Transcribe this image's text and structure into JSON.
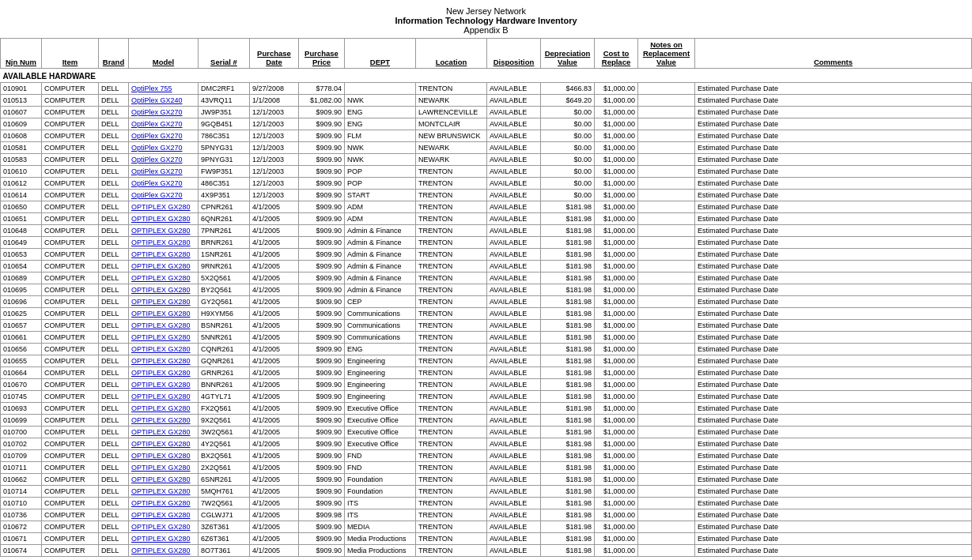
{
  "header": {
    "line1": "New Jersey Network",
    "line2": "Information Technology Hardware Inventory",
    "line3": "Appendix B"
  },
  "columns": [
    {
      "label": "Njn  Num",
      "class": "col-njn"
    },
    {
      "label": "Item",
      "class": "col-item"
    },
    {
      "label": "Brand",
      "class": "col-brand"
    },
    {
      "label": "Model",
      "class": "col-model"
    },
    {
      "label": "Serial #",
      "class": "col-serial"
    },
    {
      "label": "Purchase Date",
      "class": "col-pdate"
    },
    {
      "label": "Purchase Price",
      "class": "col-pprice"
    },
    {
      "label": "DEPT",
      "class": "col-dept"
    },
    {
      "label": "Location",
      "class": "col-location"
    },
    {
      "label": "Disposition",
      "class": "col-disp"
    },
    {
      "label": "Depreciation Value",
      "class": "col-depval"
    },
    {
      "label": "Cost to Replace",
      "class": "col-costrep"
    },
    {
      "label": "Notes on Replacement Value",
      "class": "col-notesval"
    },
    {
      "label": "Comments",
      "class": "col-comments"
    }
  ],
  "section": "AVAILABLE HARDWARE",
  "rows": [
    [
      "010901",
      "COMPUTER",
      "DELL",
      "OptiPlex 755",
      "DMC2RF1",
      "9/27/2008",
      "$778.04",
      "",
      "TRENTON",
      "AVAILABLE",
      "$466.83",
      "$1,000.00",
      "",
      "Estimated Purchase Date"
    ],
    [
      "010513",
      "COMPUTER",
      "DELL",
      "OptiPlex GX240",
      "43VRQ11",
      "1/1/2008",
      "$1,082.00",
      "NWK",
      "NEWARK",
      "AVAILABLE",
      "$649.20",
      "$1,000.00",
      "",
      "Estimated Purchase Date"
    ],
    [
      "010607",
      "COMPUTER",
      "DELL",
      "OptiPlex GX270",
      "JW9P351",
      "12/1/2003",
      "$909.90",
      "ENG",
      "LAWRENCEVILLE",
      "AVAILABLE",
      "$0.00",
      "$1,000.00",
      "",
      "Estimated Purchase Date"
    ],
    [
      "010609",
      "COMPUTER",
      "DELL",
      "OptiPlex GX270",
      "9GQB451",
      "12/1/2003",
      "$909.90",
      "ENG",
      "MONTCLAIR",
      "AVAILABLE",
      "$0.00",
      "$1,000.00",
      "",
      "Estimated Purchase Date"
    ],
    [
      "010608",
      "COMPUTER",
      "DELL",
      "OptiPlex GX270",
      "786C351",
      "12/1/2003",
      "$909.90",
      "FLM",
      "NEW BRUNSWICK",
      "AVAILABLE",
      "$0.00",
      "$1,000.00",
      "",
      "Estimated Purchase Date"
    ],
    [
      "010581",
      "COMPUTER",
      "DELL",
      "OptiPlex GX270",
      "5PNYG31",
      "12/1/2003",
      "$909.90",
      "NWK",
      "NEWARK",
      "AVAILABLE",
      "$0.00",
      "$1,000.00",
      "",
      "Estimated Purchase Date"
    ],
    [
      "010583",
      "COMPUTER",
      "DELL",
      "OptiPlex GX270",
      "9PNYG31",
      "12/1/2003",
      "$909.90",
      "NWK",
      "NEWARK",
      "AVAILABLE",
      "$0.00",
      "$1,000.00",
      "",
      "Estimated Purchase Date"
    ],
    [
      "010610",
      "COMPUTER",
      "DELL",
      "OptiPlex GX270",
      "FW9P351",
      "12/1/2003",
      "$909.90",
      "POP",
      "TRENTON",
      "AVAILABLE",
      "$0.00",
      "$1,000.00",
      "",
      "Estimated Purchase Date"
    ],
    [
      "010612",
      "COMPUTER",
      "DELL",
      "OptiPlex GX270",
      "486C351",
      "12/1/2003",
      "$909.90",
      "POP",
      "TRENTON",
      "AVAILABLE",
      "$0.00",
      "$1,000.00",
      "",
      "Estimated Purchase Date"
    ],
    [
      "010614",
      "COMPUTER",
      "DELL",
      "OptiPlex GX270",
      "4X9P351",
      "12/1/2003",
      "$909.90",
      "START",
      "TRENTON",
      "AVAILABLE",
      "$0.00",
      "$1,000.00",
      "",
      "Estimated Purchase Date"
    ],
    [
      "010650",
      "COMPUTER",
      "DELL",
      "OPTIPLEX GX280",
      "CPNR261",
      "4/1/2005",
      "$909.90",
      "ADM",
      "TRENTON",
      "AVAILABLE",
      "$181.98",
      "$1,000.00",
      "",
      "Estimated Purchase Date"
    ],
    [
      "010651",
      "COMPUTER",
      "DELL",
      "OPTIPLEX GX280",
      "6QNR261",
      "4/1/2005",
      "$909.90",
      "ADM",
      "TRENTON",
      "AVAILABLE",
      "$181.98",
      "$1,000.00",
      "",
      "Estimated Purchase Date"
    ],
    [
      "010648",
      "COMPUTER",
      "DELL",
      "OPTIPLEX GX280",
      "7PNR261",
      "4/1/2005",
      "$909.90",
      "Admin & Finance",
      "TRENTON",
      "AVAILABLE",
      "$181.98",
      "$1,000.00",
      "",
      "Estimated Purchase Date"
    ],
    [
      "010649",
      "COMPUTER",
      "DELL",
      "OPTIPLEX GX280",
      "BRNR261",
      "4/1/2005",
      "$909.90",
      "Admin & Finance",
      "TRENTON",
      "AVAILABLE",
      "$181.98",
      "$1,000.00",
      "",
      "Estimated Purchase Date"
    ],
    [
      "010653",
      "COMPUTER",
      "DELL",
      "OPTIPLEX GX280",
      "1SNR261",
      "4/1/2005",
      "$909.90",
      "Admin & Finance",
      "TRENTON",
      "AVAILABLE",
      "$181.98",
      "$1,000.00",
      "",
      "Estimated Purchase Date"
    ],
    [
      "010654",
      "COMPUTER",
      "DELL",
      "OPTIPLEX GX280",
      "9RNR261",
      "4/1/2005",
      "$909.90",
      "Admin & Finance",
      "TRENTON",
      "AVAILABLE",
      "$181.98",
      "$1,000.00",
      "",
      "Estimated Purchase Date"
    ],
    [
      "010689",
      "COMPUTER",
      "DELL",
      "OPTIPLEX GX280",
      "5X2Q561",
      "4/1/2005",
      "$909.90",
      "Admin & Finance",
      "TRENTON",
      "AVAILABLE",
      "$181.98",
      "$1,000.00",
      "",
      "Estimated Purchase Date"
    ],
    [
      "010695",
      "COMPUTER",
      "DELL",
      "OPTIPLEX GX280",
      "BY2Q561",
      "4/1/2005",
      "$909.90",
      "Admin & Finance",
      "TRENTON",
      "AVAILABLE",
      "$181.98",
      "$1,000.00",
      "",
      "Estimated Purchase Date"
    ],
    [
      "010696",
      "COMPUTER",
      "DELL",
      "OPTIPLEX GX280",
      "GY2Q561",
      "4/1/2005",
      "$909.90",
      "CEP",
      "TRENTON",
      "AVAILABLE",
      "$181.98",
      "$1,000.00",
      "",
      "Estimated Purchase Date"
    ],
    [
      "010625",
      "COMPUTER",
      "DELL",
      "OPTIPLEX GX280",
      "H9XYM56",
      "4/1/2005",
      "$909.90",
      "Communications",
      "TRENTON",
      "AVAILABLE",
      "$181.98",
      "$1,000.00",
      "",
      "Estimated Purchase Date"
    ],
    [
      "010657",
      "COMPUTER",
      "DELL",
      "OPTIPLEX GX280",
      "BSNR261",
      "4/1/2005",
      "$909.90",
      "Communications",
      "TRENTON",
      "AVAILABLE",
      "$181.98",
      "$1,000.00",
      "",
      "Estimated Purchase Date"
    ],
    [
      "010661",
      "COMPUTER",
      "DELL",
      "OPTIPLEX GX280",
      "5NNR261",
      "4/1/2005",
      "$909.90",
      "Communications",
      "TRENTON",
      "AVAILABLE",
      "$181.98",
      "$1,000.00",
      "",
      "Estimated Purchase Date"
    ],
    [
      "010656",
      "COMPUTER",
      "DELL",
      "OPTIPLEX GX280",
      "CQNR261",
      "4/1/2005",
      "$909.90",
      "ENG",
      "TRENTON",
      "AVAILABLE",
      "$181.98",
      "$1,000.00",
      "",
      "Estimated Purchase Date"
    ],
    [
      "010655",
      "COMPUTER",
      "DELL",
      "OPTIPLEX GX280",
      "GQNR261",
      "4/1/2005",
      "$909.90",
      "Engineering",
      "TRENTON",
      "AVAILABLE",
      "$181.98",
      "$1,000.00",
      "",
      "Estimated Purchase Date"
    ],
    [
      "010664",
      "COMPUTER",
      "DELL",
      "OPTIPLEX GX280",
      "GRNR261",
      "4/1/2005",
      "$909.90",
      "Engineering",
      "TRENTON",
      "AVAILABLE",
      "$181.98",
      "$1,000.00",
      "",
      "Estimated Purchase Date"
    ],
    [
      "010670",
      "COMPUTER",
      "DELL",
      "OPTIPLEX GX280",
      "BNNR261",
      "4/1/2005",
      "$909.90",
      "Engineering",
      "TRENTON",
      "AVAILABLE",
      "$181.98",
      "$1,000.00",
      "",
      "Estimated Purchase Date"
    ],
    [
      "010745",
      "COMPUTER",
      "DELL",
      "OPTIPLEX GX280",
      "4GTYL71",
      "4/1/2005",
      "$909.90",
      "Engineering",
      "TRENTON",
      "AVAILABLE",
      "$181.98",
      "$1,000.00",
      "",
      "Estimated Purchase Date"
    ],
    [
      "010693",
      "COMPUTER",
      "DELL",
      "OPTIPLEX GX280",
      "FX2Q561",
      "4/1/2005",
      "$909.90",
      "Executive Office",
      "TRENTON",
      "AVAILABLE",
      "$181.98",
      "$1,000.00",
      "",
      "Estimated Purchase Date"
    ],
    [
      "010699",
      "COMPUTER",
      "DELL",
      "OPTIPLEX GX280",
      "9X2Q561",
      "4/1/2005",
      "$909.90",
      "Executive Office",
      "TRENTON",
      "AVAILABLE",
      "$181.98",
      "$1,000.00",
      "",
      "Estimated Purchase Date"
    ],
    [
      "010700",
      "COMPUTER",
      "DELL",
      "OPTIPLEX GX280",
      "3W2Q561",
      "4/1/2005",
      "$909.90",
      "Executive Office",
      "TRENTON",
      "AVAILABLE",
      "$181.98",
      "$1,000.00",
      "",
      "Estimated Purchase Date"
    ],
    [
      "010702",
      "COMPUTER",
      "DELL",
      "OPTIPLEX GX280",
      "4Y2Q561",
      "4/1/2005",
      "$909.90",
      "Executive Office",
      "TRENTON",
      "AVAILABLE",
      "$181.98",
      "$1,000.00",
      "",
      "Estimated Purchase Date"
    ],
    [
      "010709",
      "COMPUTER",
      "DELL",
      "OPTIPLEX GX280",
      "BX2Q561",
      "4/1/2005",
      "$909.90",
      "FND",
      "TRENTON",
      "AVAILABLE",
      "$181.98",
      "$1,000.00",
      "",
      "Estimated Purchase Date"
    ],
    [
      "010711",
      "COMPUTER",
      "DELL",
      "OPTIPLEX GX280",
      "2X2Q561",
      "4/1/2005",
      "$909.90",
      "FND",
      "TRENTON",
      "AVAILABLE",
      "$181.98",
      "$1,000.00",
      "",
      "Estimated Purchase Date"
    ],
    [
      "010662",
      "COMPUTER",
      "DELL",
      "OPTIPLEX GX280",
      "6SNR261",
      "4/1/2005",
      "$909.90",
      "Foundation",
      "TRENTON",
      "AVAILABLE",
      "$181.98",
      "$1,000.00",
      "",
      "Estimated Purchase Date"
    ],
    [
      "010714",
      "COMPUTER",
      "DELL",
      "OPTIPLEX GX280",
      "5MQH761",
      "4/1/2005",
      "$909.90",
      "Foundation",
      "TRENTON",
      "AVAILABLE",
      "$181.98",
      "$1,000.00",
      "",
      "Estimated Purchase Date"
    ],
    [
      "010710",
      "COMPUTER",
      "DELL",
      "OPTIPLEX GX280",
      "7W2Q561",
      "4/1/2005",
      "$909.90",
      "ITS",
      "TRENTON",
      "AVAILABLE",
      "$181.98",
      "$1,000.00",
      "",
      "Estimated Purchase Date"
    ],
    [
      "010736",
      "COMPUTER",
      "DELL",
      "OPTIPLEX GX280",
      "CGLWJ71",
      "4/1/2005",
      "$909.98",
      "ITS",
      "TRENTON",
      "AVAILABLE",
      "$181.98",
      "$1,000.00",
      "",
      "Estimated Purchase Date"
    ],
    [
      "010672",
      "COMPUTER",
      "DELL",
      "OPTIPLEX GX280",
      "3Z6T361",
      "4/1/2005",
      "$909.90",
      "MEDIA",
      "TRENTON",
      "AVAILABLE",
      "$181.98",
      "$1,000.00",
      "",
      "Estimated Purchase Date"
    ],
    [
      "010671",
      "COMPUTER",
      "DELL",
      "OPTIPLEX GX280",
      "6Z6T361",
      "4/1/2005",
      "$909.90",
      "Media Productions",
      "TRENTON",
      "AVAILABLE",
      "$181.98",
      "$1,000.00",
      "",
      "Estimated Purchase Date"
    ],
    [
      "010674",
      "COMPUTER",
      "DELL",
      "OPTIPLEX GX280",
      "8O7T361",
      "4/1/2005",
      "$909.90",
      "Media Productions",
      "TRENTON",
      "AVAILABLE",
      "$181.98",
      "$1,000.00",
      "",
      "Estimated Purchase Date"
    ]
  ]
}
